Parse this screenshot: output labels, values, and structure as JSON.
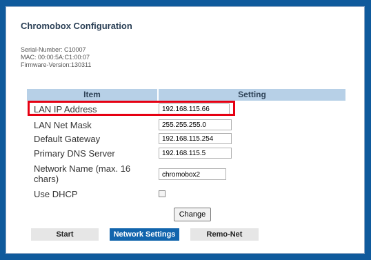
{
  "app": {
    "title": "Chromobox Configuration"
  },
  "device": {
    "serial": "Serial-Number: C10007",
    "mac": "MAC: 00:00:5A:C1:00:07",
    "firmware": "Firmware-Version:130311"
  },
  "table": {
    "header_item": "Item",
    "header_setting": "Setting",
    "rows": [
      {
        "label": "LAN IP Address",
        "value": "192.168.115.66"
      },
      {
        "label": "LAN Net Mask",
        "value": "255.255.255.0"
      },
      {
        "label": "Default Gateway",
        "value": "192.168.115.254"
      },
      {
        "label": "Primary DNS Server",
        "value": "192.168.115.5"
      },
      {
        "label": "Network Name (max. 16 chars)",
        "value": "chromobox2"
      },
      {
        "label": "Use DHCP",
        "checked": false
      }
    ]
  },
  "actions": {
    "change_label": "Change"
  },
  "nav": [
    {
      "label": "Start"
    },
    {
      "label": "Network Settings",
      "active": true
    },
    {
      "label": "Remo-Net"
    }
  ],
  "colors": {
    "background": "#0f5a9c",
    "header": "#b7d0e7",
    "highlight": "#e60012",
    "nav_active": "#1265ad"
  }
}
